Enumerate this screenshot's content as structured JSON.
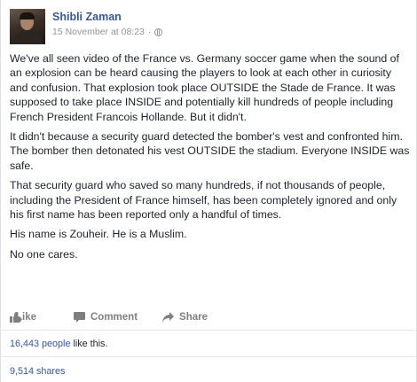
{
  "post": {
    "author": "Shibli Zaman",
    "timestamp": "15 November at 08:23",
    "separator": "·",
    "audience_icon": "globe-icon",
    "paragraphs": [
      "We've all seen video of the France vs. Germany soccer game when the sound of an explosion can be heard causing the players to look at each other in curiosity and confusion. That explosion took place OUTSIDE the Stade de France. It was supposed to take place INSIDE and potentially kill hundreds of people including French President Francois Hollande. But it didn't.",
      "It didn't because a security guard detected the bomber's vest and confronted him. The bomber then detonated his vest OUTSIDE the stadium. Everyone INSIDE was safe.",
      "That security guard who saved so many hundreds, if not thousands of people, including the President of France himself, has been completely ignored and only his first name has been reported only a handful of times.",
      "His name is Zouheir. He is a Muslim.",
      "No one cares."
    ]
  },
  "actions": {
    "like": {
      "label": "Like",
      "icon": "thumbs-up-icon"
    },
    "comment": {
      "label": "Comment",
      "icon": "comment-bubble-icon"
    },
    "share": {
      "label": "Share",
      "icon": "share-arrow-icon"
    }
  },
  "stats": {
    "likes_count": "16,443 people",
    "likes_suffix": " like this.",
    "shares": "9,514 shares"
  },
  "colors": {
    "link": "#365899",
    "text": "#1d2129",
    "muted": "#90949c",
    "action": "#7f7f7f"
  }
}
